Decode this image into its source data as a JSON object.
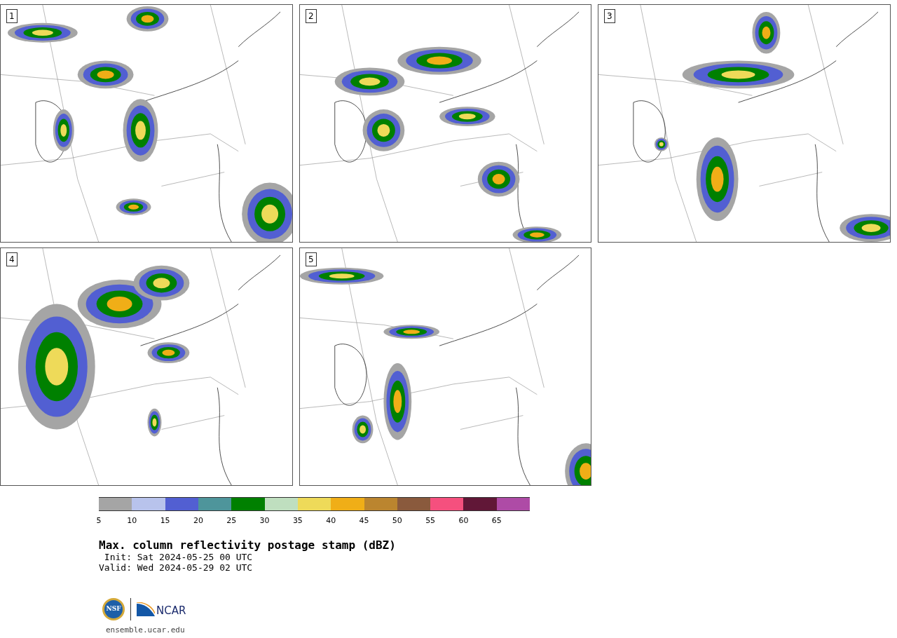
{
  "panels": [
    {
      "label": "1"
    },
    {
      "label": "2"
    },
    {
      "label": "3"
    },
    {
      "label": "4"
    },
    {
      "label": "5"
    }
  ],
  "colorbar": [
    {
      "tick": "5",
      "color": "#a5a5a5"
    },
    {
      "tick": "10",
      "color": "#b8c3ec"
    },
    {
      "tick": "15",
      "color": "#525fd2"
    },
    {
      "tick": "20",
      "color": "#4e959b"
    },
    {
      "tick": "25",
      "color": "#008000"
    },
    {
      "tick": "30",
      "color": "#bfdfbf"
    },
    {
      "tick": "35",
      "color": "#eeda59"
    },
    {
      "tick": "40",
      "color": "#f0ae17"
    },
    {
      "tick": "45",
      "color": "#bb852f"
    },
    {
      "tick": "50",
      "color": "#8a5a3d"
    },
    {
      "tick": "55",
      "color": "#f5507e"
    },
    {
      "tick": "60",
      "color": "#611737"
    },
    {
      "tick": "65",
      "color": "#ae4ba6"
    }
  ],
  "title": "Max. column reflectivity postage stamp (dBZ)",
  "init": " Init: Sat 2024-05-25 00 UTC",
  "valid": "Valid: Wed 2024-05-29 02 UTC",
  "logo": {
    "left": "NSF",
    "right": "NCAR"
  },
  "footer_link": "ensemble.ucar.edu"
}
